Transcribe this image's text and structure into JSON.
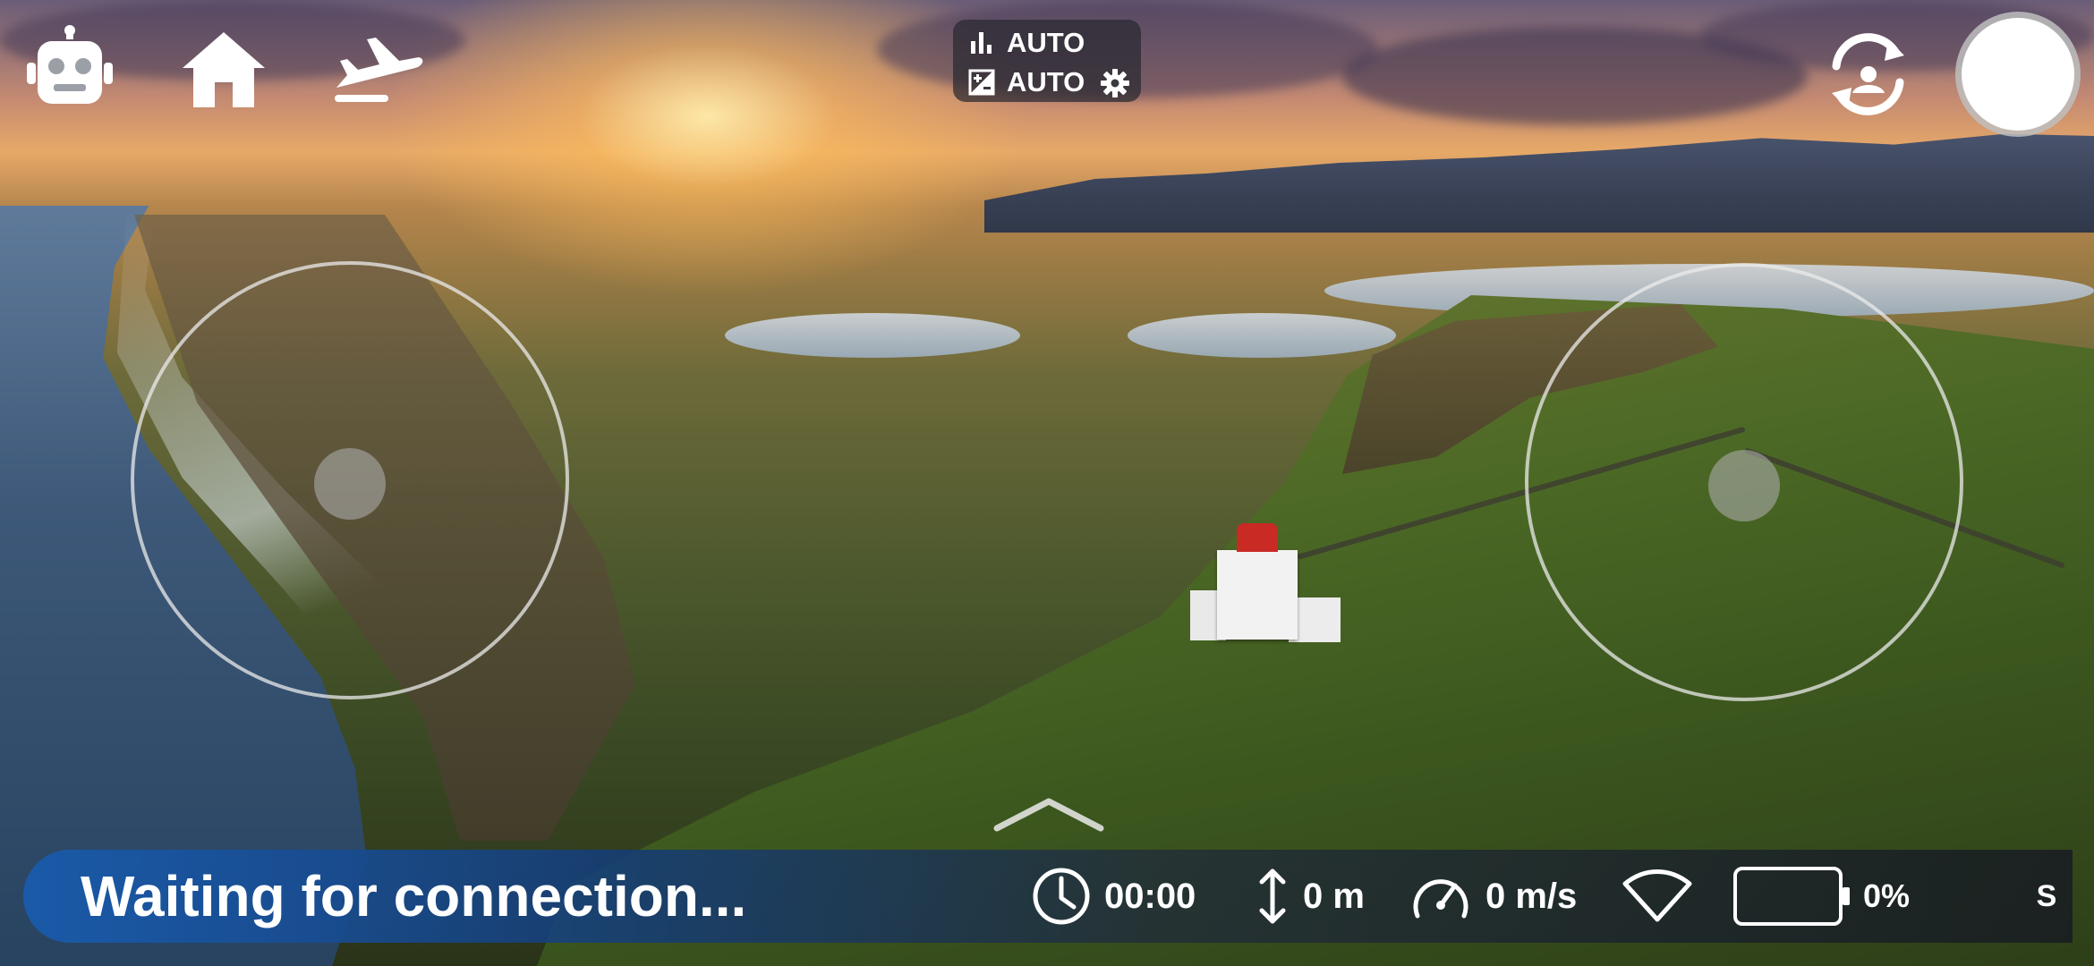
{
  "app": {
    "top_buttons": [
      {
        "name": "robot-mode",
        "icon": "robot-icon"
      },
      {
        "name": "home",
        "icon": "home-icon"
      },
      {
        "name": "flight-mode",
        "icon": "airplane-icon"
      }
    ]
  },
  "camera_settings": {
    "iso_label": "AUTO",
    "exposure_label": "AUTO",
    "iso_icon": "bar-chart-icon",
    "exposure_icon": "exposure-icon",
    "settings_icon": "gear-icon"
  },
  "controls": {
    "switch_camera_icon": "switch-camera-icon",
    "record_button_icon": "record-circle"
  },
  "joysticks": {
    "left": {
      "name": "left-joystick"
    },
    "right": {
      "name": "right-joystick"
    }
  },
  "status_bar": {
    "message": "Waiting for connection...",
    "flight_time": "00:00",
    "altitude": "0 m",
    "speed": "0 m/s",
    "battery_percent": "0%",
    "battery_level": 0,
    "mode": "S",
    "icons": {
      "time": "clock-icon",
      "altitude": "vertical-arrows-icon",
      "speed": "speedometer-icon",
      "signal": "wifi-icon",
      "battery": "battery-icon"
    }
  },
  "colors": {
    "status_gradient_start": "#1a5aa8",
    "record_button": "#ffffff",
    "lighthouse_roof": "#c92a24"
  }
}
